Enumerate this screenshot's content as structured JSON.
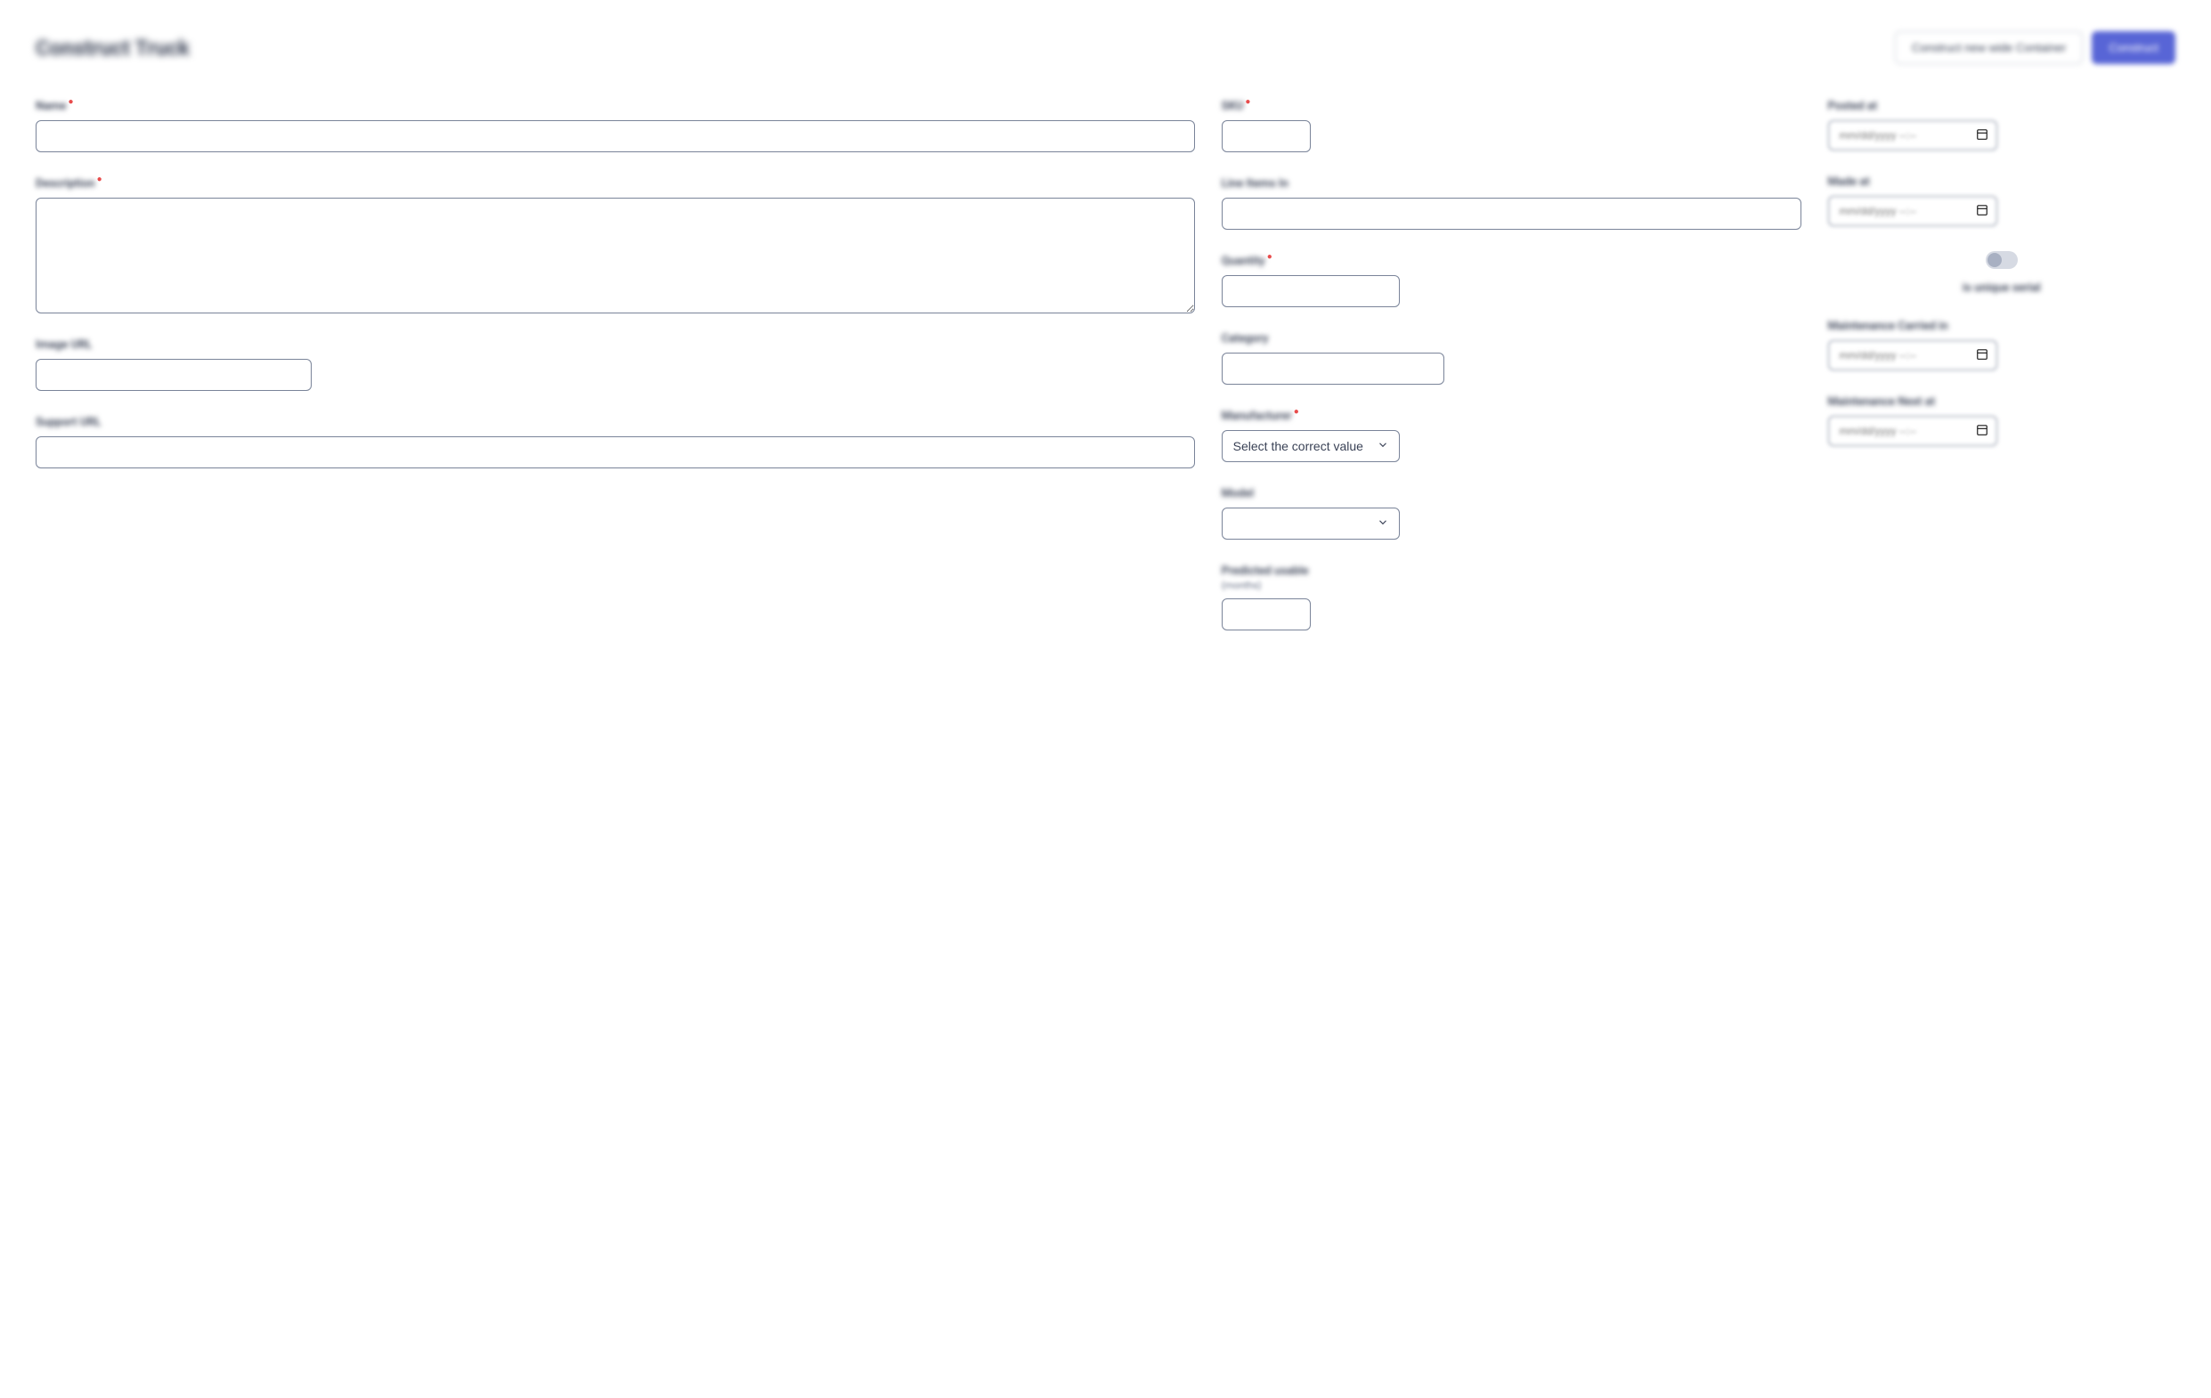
{
  "header": {
    "title": "Construct Truck",
    "secondary_btn": "Construct new wide Container",
    "primary_btn": "Construct"
  },
  "col1": {
    "name": {
      "label": "Name",
      "required": true
    },
    "description": {
      "label": "Description",
      "required": true
    },
    "image_url": {
      "label": "Image URL"
    },
    "support_url": {
      "label": "Support URL"
    }
  },
  "col2": {
    "sku": {
      "label": "SKU",
      "required": true
    },
    "line_items_in": {
      "label": "Line Items In"
    },
    "quantity": {
      "label": "Quantity",
      "required": true
    },
    "category": {
      "label": "Category"
    },
    "manufacturer": {
      "label": "Manufacturer",
      "required": true,
      "placeholder": "Select the correct value"
    },
    "model": {
      "label": "Model"
    },
    "predicted_usable": {
      "label": "Predicted usable",
      "sublabel": "(months)"
    }
  },
  "col3": {
    "posted_at": {
      "label": "Posted at",
      "placeholder": "mm/dd/yyyy --:--"
    },
    "made_at": {
      "label": "Made at",
      "placeholder": "mm/dd/yyyy --:--"
    },
    "toggle": {
      "label": "is unique serial"
    },
    "maintenance_carried": {
      "label": "Maintenance Carried in",
      "placeholder": "mm/dd/yyyy --:--"
    },
    "maintenance_next": {
      "label": "Maintenance Next at",
      "placeholder": "mm/dd/yyyy --:--"
    }
  }
}
